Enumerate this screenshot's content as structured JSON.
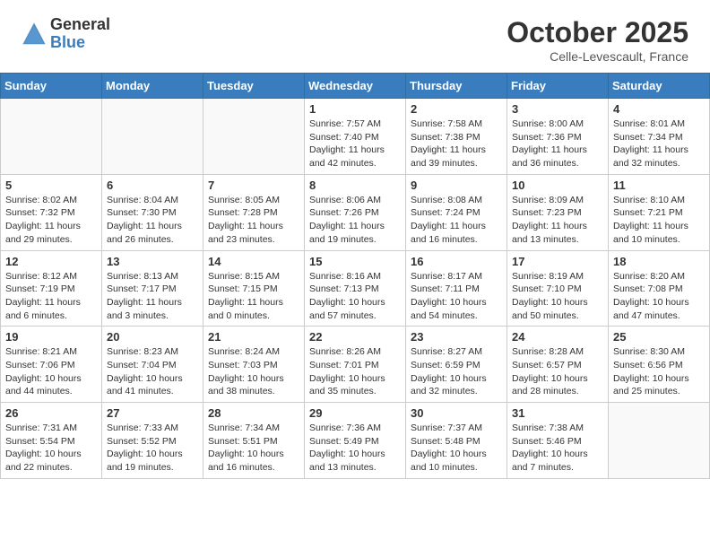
{
  "header": {
    "logo_general": "General",
    "logo_blue": "Blue",
    "month_title": "October 2025",
    "location": "Celle-Levescault, France"
  },
  "weekdays": [
    "Sunday",
    "Monday",
    "Tuesday",
    "Wednesday",
    "Thursday",
    "Friday",
    "Saturday"
  ],
  "weeks": [
    [
      {
        "day": "",
        "info": ""
      },
      {
        "day": "",
        "info": ""
      },
      {
        "day": "",
        "info": ""
      },
      {
        "day": "1",
        "info": "Sunrise: 7:57 AM\nSunset: 7:40 PM\nDaylight: 11 hours and 42 minutes."
      },
      {
        "day": "2",
        "info": "Sunrise: 7:58 AM\nSunset: 7:38 PM\nDaylight: 11 hours and 39 minutes."
      },
      {
        "day": "3",
        "info": "Sunrise: 8:00 AM\nSunset: 7:36 PM\nDaylight: 11 hours and 36 minutes."
      },
      {
        "day": "4",
        "info": "Sunrise: 8:01 AM\nSunset: 7:34 PM\nDaylight: 11 hours and 32 minutes."
      }
    ],
    [
      {
        "day": "5",
        "info": "Sunrise: 8:02 AM\nSunset: 7:32 PM\nDaylight: 11 hours and 29 minutes."
      },
      {
        "day": "6",
        "info": "Sunrise: 8:04 AM\nSunset: 7:30 PM\nDaylight: 11 hours and 26 minutes."
      },
      {
        "day": "7",
        "info": "Sunrise: 8:05 AM\nSunset: 7:28 PM\nDaylight: 11 hours and 23 minutes."
      },
      {
        "day": "8",
        "info": "Sunrise: 8:06 AM\nSunset: 7:26 PM\nDaylight: 11 hours and 19 minutes."
      },
      {
        "day": "9",
        "info": "Sunrise: 8:08 AM\nSunset: 7:24 PM\nDaylight: 11 hours and 16 minutes."
      },
      {
        "day": "10",
        "info": "Sunrise: 8:09 AM\nSunset: 7:23 PM\nDaylight: 11 hours and 13 minutes."
      },
      {
        "day": "11",
        "info": "Sunrise: 8:10 AM\nSunset: 7:21 PM\nDaylight: 11 hours and 10 minutes."
      }
    ],
    [
      {
        "day": "12",
        "info": "Sunrise: 8:12 AM\nSunset: 7:19 PM\nDaylight: 11 hours and 6 minutes."
      },
      {
        "day": "13",
        "info": "Sunrise: 8:13 AM\nSunset: 7:17 PM\nDaylight: 11 hours and 3 minutes."
      },
      {
        "day": "14",
        "info": "Sunrise: 8:15 AM\nSunset: 7:15 PM\nDaylight: 11 hours and 0 minutes."
      },
      {
        "day": "15",
        "info": "Sunrise: 8:16 AM\nSunset: 7:13 PM\nDaylight: 10 hours and 57 minutes."
      },
      {
        "day": "16",
        "info": "Sunrise: 8:17 AM\nSunset: 7:11 PM\nDaylight: 10 hours and 54 minutes."
      },
      {
        "day": "17",
        "info": "Sunrise: 8:19 AM\nSunset: 7:10 PM\nDaylight: 10 hours and 50 minutes."
      },
      {
        "day": "18",
        "info": "Sunrise: 8:20 AM\nSunset: 7:08 PM\nDaylight: 10 hours and 47 minutes."
      }
    ],
    [
      {
        "day": "19",
        "info": "Sunrise: 8:21 AM\nSunset: 7:06 PM\nDaylight: 10 hours and 44 minutes."
      },
      {
        "day": "20",
        "info": "Sunrise: 8:23 AM\nSunset: 7:04 PM\nDaylight: 10 hours and 41 minutes."
      },
      {
        "day": "21",
        "info": "Sunrise: 8:24 AM\nSunset: 7:03 PM\nDaylight: 10 hours and 38 minutes."
      },
      {
        "day": "22",
        "info": "Sunrise: 8:26 AM\nSunset: 7:01 PM\nDaylight: 10 hours and 35 minutes."
      },
      {
        "day": "23",
        "info": "Sunrise: 8:27 AM\nSunset: 6:59 PM\nDaylight: 10 hours and 32 minutes."
      },
      {
        "day": "24",
        "info": "Sunrise: 8:28 AM\nSunset: 6:57 PM\nDaylight: 10 hours and 28 minutes."
      },
      {
        "day": "25",
        "info": "Sunrise: 8:30 AM\nSunset: 6:56 PM\nDaylight: 10 hours and 25 minutes."
      }
    ],
    [
      {
        "day": "26",
        "info": "Sunrise: 7:31 AM\nSunset: 5:54 PM\nDaylight: 10 hours and 22 minutes."
      },
      {
        "day": "27",
        "info": "Sunrise: 7:33 AM\nSunset: 5:52 PM\nDaylight: 10 hours and 19 minutes."
      },
      {
        "day": "28",
        "info": "Sunrise: 7:34 AM\nSunset: 5:51 PM\nDaylight: 10 hours and 16 minutes."
      },
      {
        "day": "29",
        "info": "Sunrise: 7:36 AM\nSunset: 5:49 PM\nDaylight: 10 hours and 13 minutes."
      },
      {
        "day": "30",
        "info": "Sunrise: 7:37 AM\nSunset: 5:48 PM\nDaylight: 10 hours and 10 minutes."
      },
      {
        "day": "31",
        "info": "Sunrise: 7:38 AM\nSunset: 5:46 PM\nDaylight: 10 hours and 7 minutes."
      },
      {
        "day": "",
        "info": ""
      }
    ]
  ]
}
